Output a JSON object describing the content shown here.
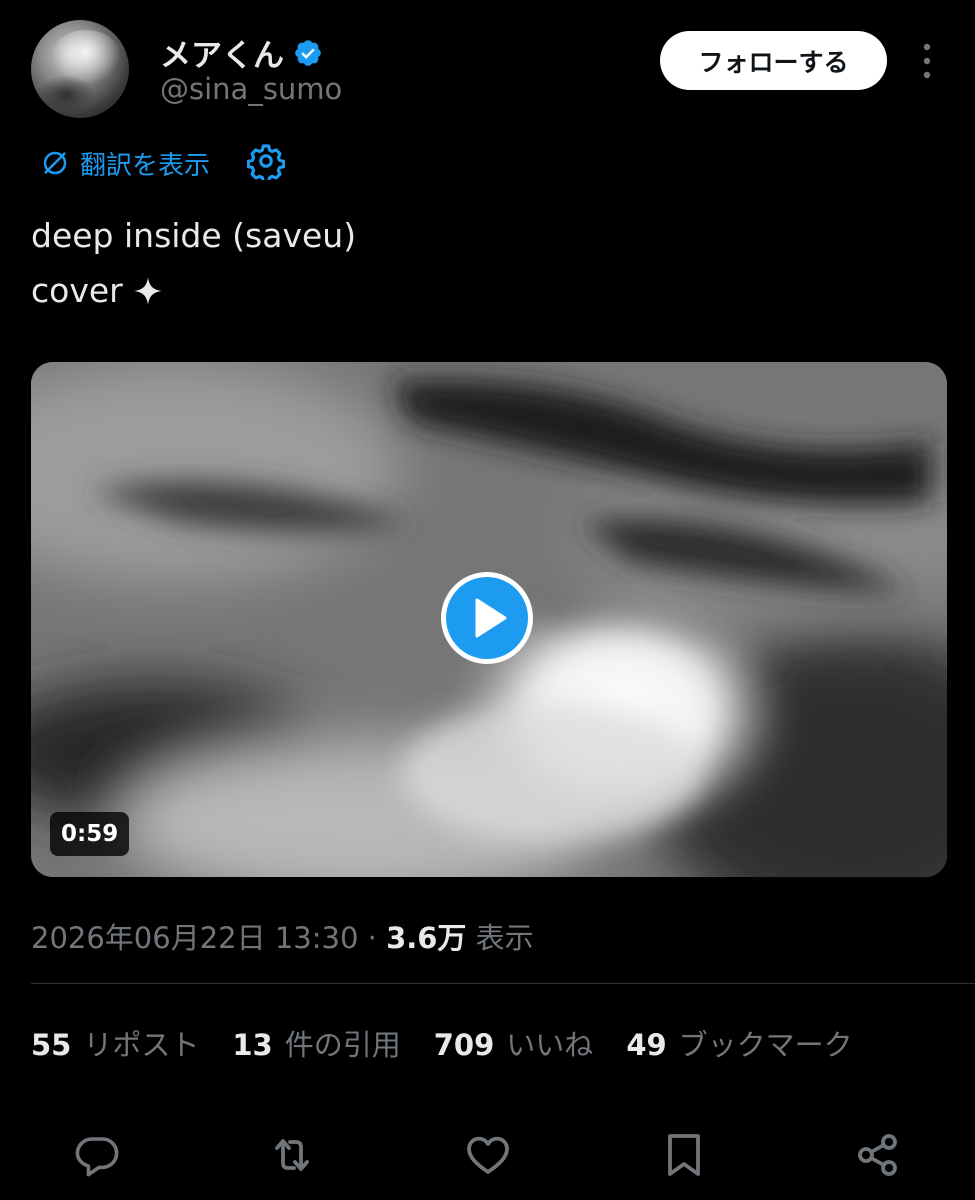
{
  "author": {
    "display_name": "メアくん",
    "handle": "@sina_sumo",
    "verified_icon": "verified-badge-icon",
    "avatar_icon": "avatar-image"
  },
  "header": {
    "follow_label": "フォローする",
    "more_icon": "more-vertical-icon"
  },
  "translate": {
    "label": "翻訳を表示",
    "icon": "translate-icon",
    "settings_icon": "gear-icon"
  },
  "tweet": {
    "line1": "deep inside (saveu)",
    "line2": "cover",
    "emoji_icon": "sparkle-icon"
  },
  "media": {
    "type": "video",
    "duration": "0:59",
    "play_icon": "play-icon"
  },
  "meta": {
    "datetime": "2026年06月22日 13:30",
    "separator": " · ",
    "views_count": "3.6万",
    "views_label": " 表示"
  },
  "stats": [
    {
      "count": "55",
      "label": "リポスト"
    },
    {
      "count": "13",
      "label": "件の引用"
    },
    {
      "count": "709",
      "label": "いいね"
    },
    {
      "count": "49",
      "label": "ブックマーク"
    }
  ],
  "actions": [
    {
      "name": "reply",
      "icon": "reply-icon"
    },
    {
      "name": "repost",
      "icon": "repost-icon"
    },
    {
      "name": "like",
      "icon": "heart-icon"
    },
    {
      "name": "bookmark",
      "icon": "bookmark-icon"
    },
    {
      "name": "share",
      "icon": "share-icon"
    }
  ],
  "colors": {
    "background": "#000000",
    "text_primary": "#e7e9ea",
    "text_secondary": "#71767b",
    "accent": "#1d9bf0",
    "divider": "#2f3336"
  }
}
